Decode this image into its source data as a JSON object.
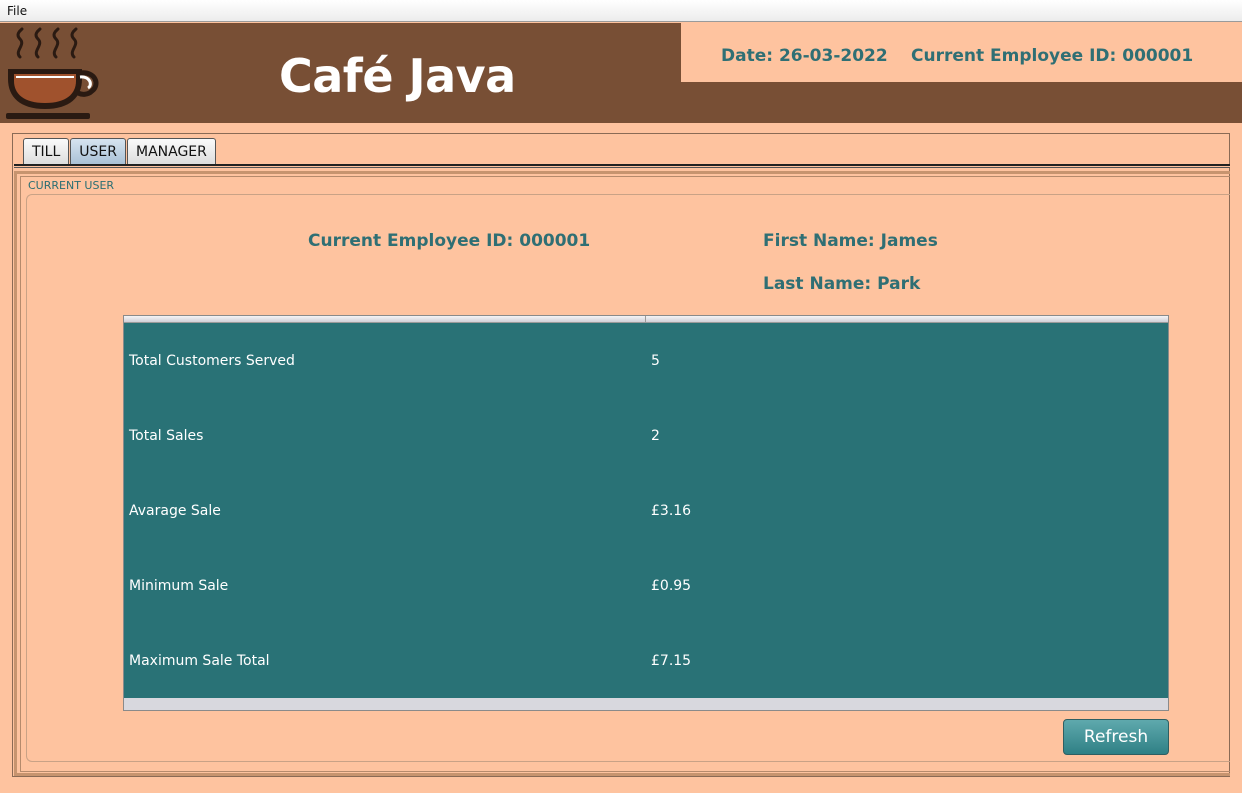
{
  "menubar": {
    "file": "File"
  },
  "header": {
    "title": "Café Java",
    "date": "Date: 26-03-2022",
    "employee": "Current Employee ID: 000001",
    "colors": {
      "brown": "#784f35",
      "peach": "#fec39f",
      "teal": "#2a6e73"
    }
  },
  "tabs": [
    {
      "label": "TILL"
    },
    {
      "label": "USER"
    },
    {
      "label": "MANAGER"
    }
  ],
  "active_tab": "USER",
  "panel": {
    "group_title": "CURRENT USER",
    "employee_id": "Current Employee ID: 000001",
    "first_name": "First Name: James",
    "last_name": "Last Name: Park"
  },
  "stats": [
    {
      "name": "Total Customers Served",
      "value": "5"
    },
    {
      "name": "Total Sales",
      "value": "2"
    },
    {
      "name": "Avarage Sale",
      "value": "£3.16"
    },
    {
      "name": "Minimum Sale",
      "value": "£0.95"
    },
    {
      "name": "Maximum Sale Total",
      "value": "£7.15"
    }
  ],
  "refresh_label": "Refresh",
  "icons": {
    "logo": "coffee-cup-icon"
  }
}
